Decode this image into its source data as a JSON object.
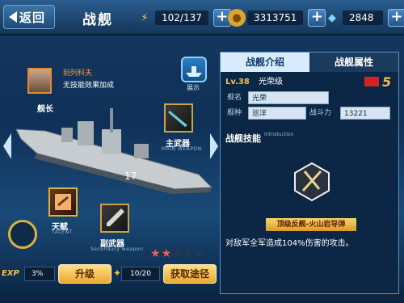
{
  "topbar": {
    "back_label": "返回",
    "title": "战舰",
    "energy": "102/137",
    "gold": "3313751",
    "diamond": "2848"
  },
  "commander": {
    "name": "别列科夫",
    "desc": "无技能效果加成",
    "label": "舰长"
  },
  "show_label": "展示",
  "main_weapon": {
    "label": "主武器",
    "sub": "MAIN WEAPON"
  },
  "talent": {
    "label": "天赋",
    "sub": "TALENT"
  },
  "secondary_weapon": {
    "label": "副武器",
    "sub": "Secondary weapon"
  },
  "stars": {
    "filled": 2,
    "total": 5
  },
  "bottom": {
    "exp_label": "EXP",
    "exp_percent": "3%",
    "upgrade_label": "升级",
    "fragments": "10/20",
    "obtain_label": "获取途径"
  },
  "panel": {
    "tab_intro": "战舰介绍",
    "tab_attr": "战舰属性",
    "level": "Lv.38",
    "ship_class": "光荣级",
    "name_label": "舰名",
    "name_value": "光荣",
    "type_label": "舰种",
    "type_value": "巡洋",
    "power_label": "战斗力",
    "power_value": "13221",
    "rank": "5",
    "skill_title": "战舰技能",
    "skill_sub": "Introduction",
    "skill_name": "顶级反舰-火山岩导弹",
    "skill_desc": "对敌军全军造成104%伤害的攻击。"
  },
  "colors": {
    "accent": "#f2c04a",
    "tab_active": "#d9ecff",
    "commander_name": "#ff9a3a"
  }
}
